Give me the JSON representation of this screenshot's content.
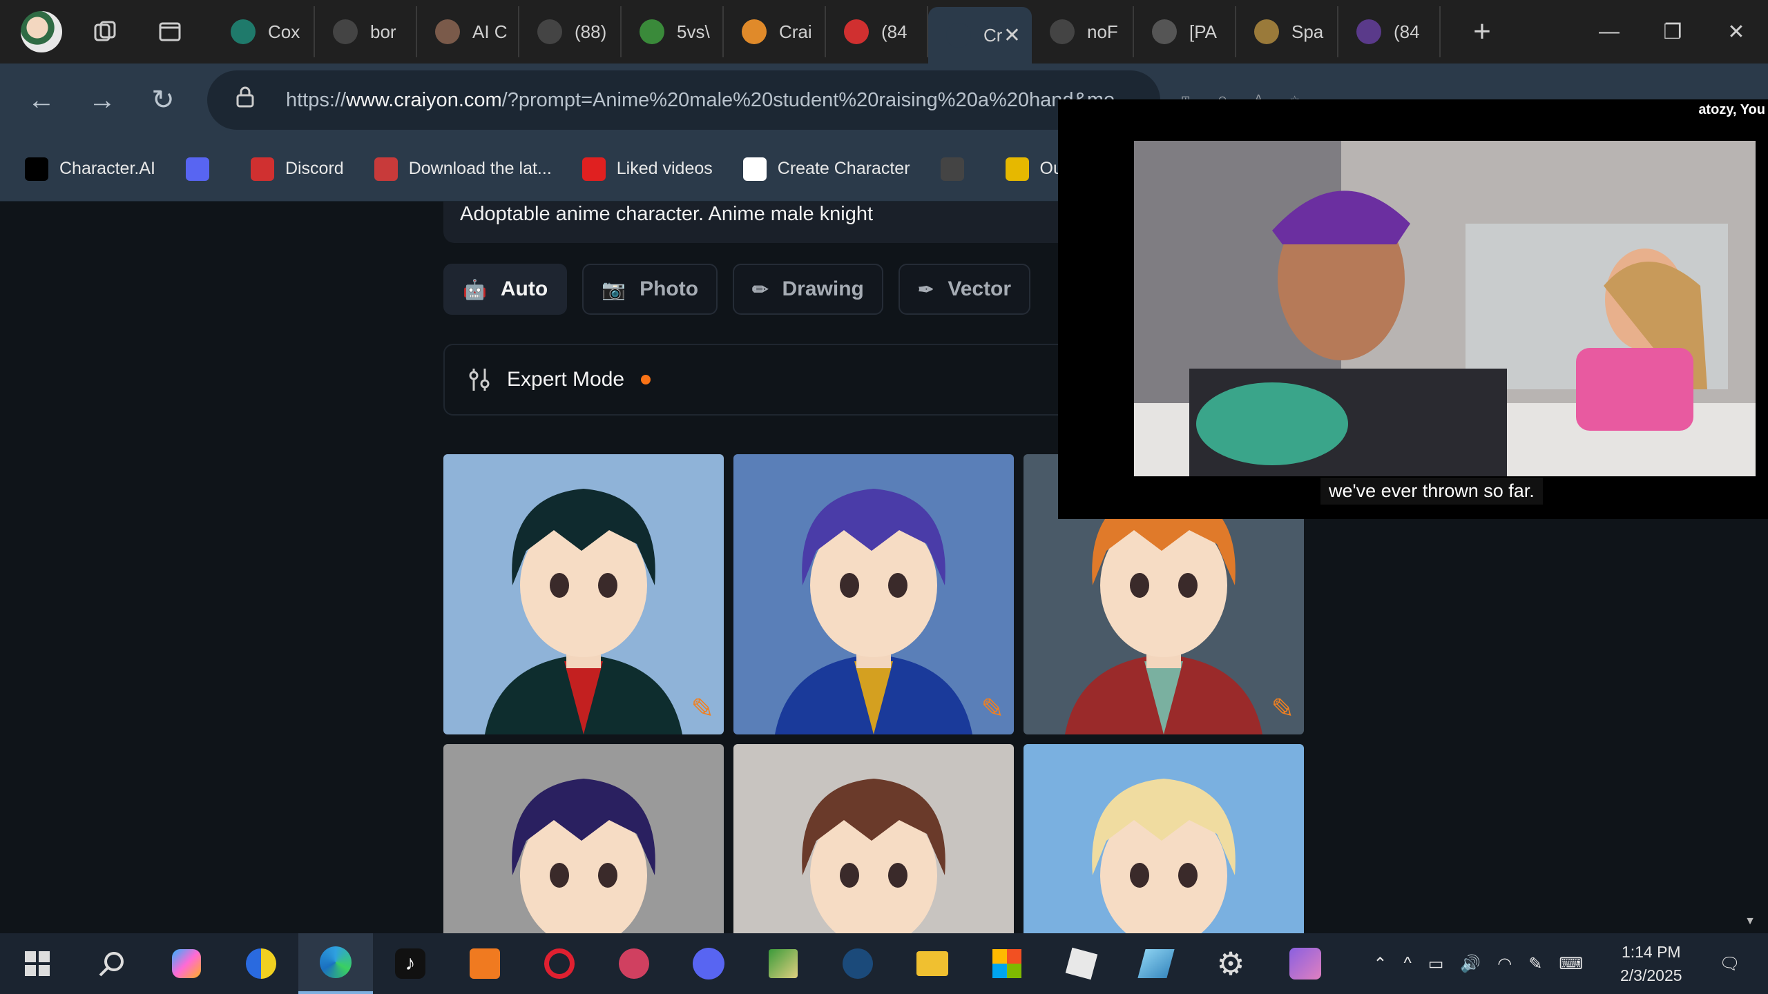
{
  "browser": {
    "tabs": [
      {
        "label": "Cox",
        "color": "#1f7a6b"
      },
      {
        "label": "bor",
        "color": "#444"
      },
      {
        "label": "AI C",
        "color": "#7a5a4a"
      },
      {
        "label": "(88)",
        "color": "#444"
      },
      {
        "label": "5vs\\",
        "color": "#3a8a3a"
      },
      {
        "label": "Crai",
        "color": "#e08a2a"
      },
      {
        "label": "(84",
        "color": "#d03030"
      },
      {
        "label": "Cr",
        "color": "#2b3a4a"
      },
      {
        "label": "noF",
        "color": "#444"
      },
      {
        "label": "[PA",
        "color": "#555"
      },
      {
        "label": "Spa",
        "color": "#9a7a3a"
      },
      {
        "label": "(84",
        "color": "#5a3a8a"
      }
    ],
    "active_tab_index": 7,
    "new_tab_label": "+",
    "address": {
      "prefix": "https://",
      "domain": "www.craiyon.com",
      "path": "/?prompt=Anime%20male%20student%20raising%20a%20hand&mo"
    },
    "bookmarks": [
      {
        "label": "Character.AI",
        "icon": "c.ai",
        "color": "#000"
      },
      {
        "label": "",
        "icon": "discord-icon",
        "color": "#5865f2"
      },
      {
        "label": "Discord",
        "icon": "8k+",
        "color": "#d03030"
      },
      {
        "label": "Download the lat...",
        "icon": "store",
        "color": "#c83a3a"
      },
      {
        "label": "Liked videos",
        "icon": "youtube",
        "color": "#e02020"
      },
      {
        "label": "Create Character",
        "icon": "openai",
        "color": "#fff"
      },
      {
        "label": "",
        "icon": "doc",
        "color": "#444"
      },
      {
        "label": "Outp",
        "icon": "u",
        "color": "#e6b800"
      }
    ]
  },
  "craiyon": {
    "prompt_text": "Adoptable anime character. Anime male knight",
    "modes": [
      {
        "label": "Auto",
        "selected": true
      },
      {
        "label": "Photo",
        "selected": false
      },
      {
        "label": "Drawing",
        "selected": false
      },
      {
        "label": "Vector",
        "selected": false
      }
    ],
    "expert_mode_label": "Expert Mode",
    "results": [
      {
        "hair": "#0f2a2e",
        "bg": "#8fb3d8",
        "outfit": "#0e2d2e",
        "accent": "#c32020"
      },
      {
        "hair": "#4a3ca8",
        "bg": "#5a7fb8",
        "outfit": "#1a3a9a",
        "accent": "#d4a020"
      },
      {
        "hair": "#e07a2a",
        "bg": "#4a5a68",
        "outfit": "#9a2a2a",
        "accent": "#7ab0a0"
      },
      {
        "hair": "#2a2060",
        "bg": "#9a9a9a",
        "outfit": "#2a1a4a",
        "accent": "#f0f0f0"
      },
      {
        "hair": "#6a3a2a",
        "bg": "#c8c4c0",
        "outfit": "#3a2a2a",
        "accent": "#e8c0a0"
      },
      {
        "hair": "#f0dca0",
        "bg": "#7ab0e0",
        "outfit": "#3a6a3a",
        "accent": "#c02020"
      }
    ]
  },
  "pip": {
    "title": "atozy, You",
    "caption": "we've ever thrown so far."
  },
  "taskbar": {
    "time": "1:14 PM",
    "date": "2/3/2025"
  }
}
